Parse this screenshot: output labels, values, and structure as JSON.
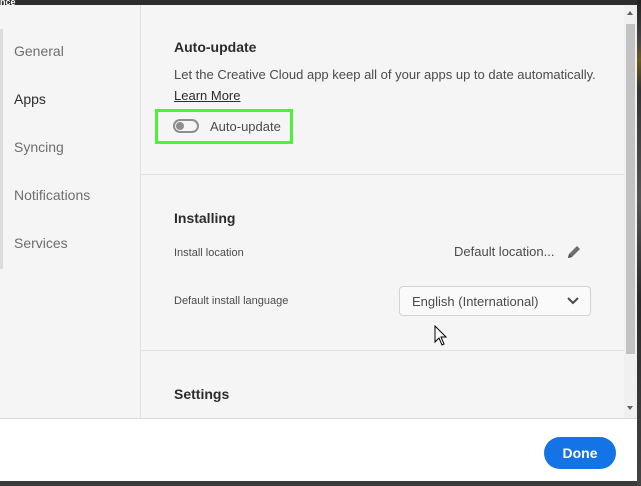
{
  "window": {
    "title_fragment": "nce"
  },
  "sidebar": {
    "items": [
      {
        "label": "General"
      },
      {
        "label": "Apps"
      },
      {
        "label": "Syncing"
      },
      {
        "label": "Notifications"
      },
      {
        "label": "Services"
      }
    ],
    "active": "Apps"
  },
  "auto_update": {
    "heading": "Auto-update",
    "description": "Let the Creative Cloud app keep all of your apps up to date automatically.",
    "learn_more": "Learn More",
    "toggle_label": "Auto-update",
    "toggle_on": false,
    "highlight_color": "#4ff03a"
  },
  "installing": {
    "heading": "Installing",
    "install_location_label": "Install location",
    "install_location_value": "Default location...",
    "language_label": "Default install language",
    "language_value": "English (International)"
  },
  "settings": {
    "heading": "Settings"
  },
  "footer": {
    "done_label": "Done"
  },
  "colors": {
    "accent": "#1473e6",
    "highlight": "#4ff03a"
  },
  "icons": [
    "pencil-icon",
    "chevron-down-icon",
    "mouse-cursor-icon",
    "toggle-switch"
  ]
}
